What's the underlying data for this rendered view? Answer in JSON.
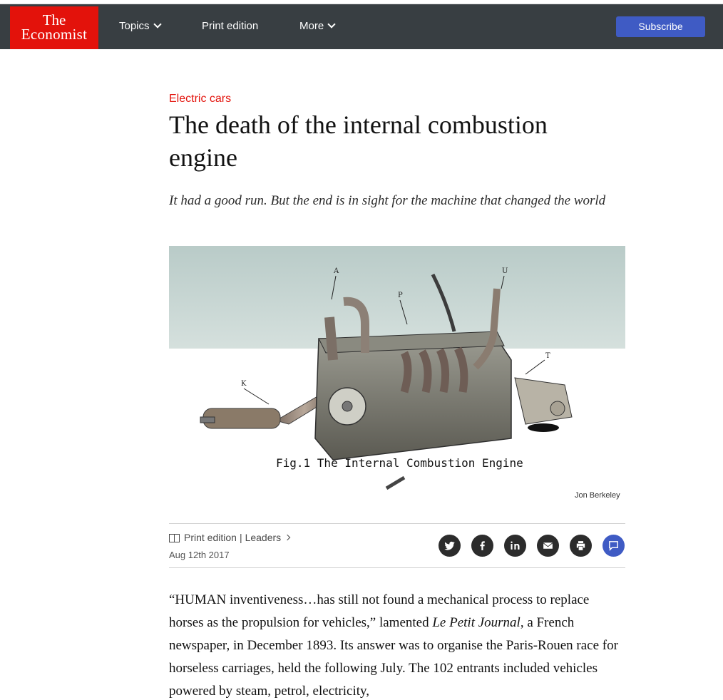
{
  "brand": {
    "line1": "The",
    "line2": "Economist",
    "color": "#e3120b"
  },
  "nav": {
    "topics": "Topics",
    "print_edition": "Print edition",
    "more": "More",
    "subscribe": "Subscribe"
  },
  "article": {
    "section": "Electric cars",
    "headline": "The death of the internal combustion engine",
    "rubric": "It had a good run. But the end is in sight for the machine that changed the world",
    "image": {
      "caption": "Fig.1 The Internal Combustion Engine",
      "labels": [
        "A",
        "P",
        "U",
        "K",
        "T"
      ],
      "credit": "Jon Berkeley"
    },
    "meta": {
      "print_edition": "Print edition",
      "section_link": "Leaders",
      "date": "Aug 12th 2017"
    },
    "share_icons": [
      "twitter-icon",
      "facebook-icon",
      "linkedin-icon",
      "email-icon",
      "print-icon",
      "comment-icon"
    ],
    "body": {
      "part1": "“HUMAN inventiveness…has still not found a mechanical process to replace horses as the propulsion for vehicles,” lamented ",
      "publication": "Le Petit Journal",
      "part2": ", a French newspaper, in December 1893. Its answer was to organise the Paris-Rouen race for horseless carriages, held the following July. The 102 entrants included vehicles powered by steam, petrol, electricity,"
    }
  },
  "colors": {
    "navbar": "#383e42",
    "accent": "#3f5bc4",
    "section": "#e3120b"
  }
}
